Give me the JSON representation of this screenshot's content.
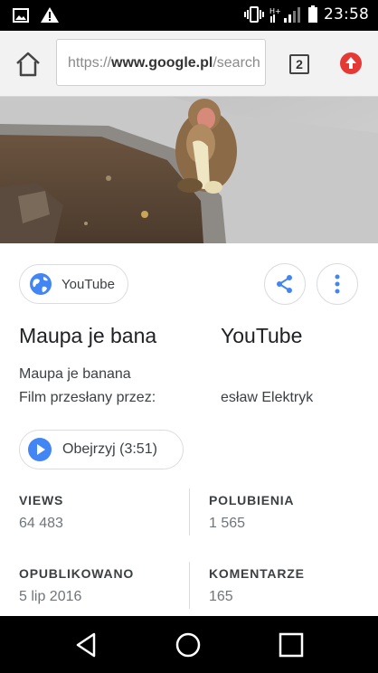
{
  "status_bar": {
    "time": "23:58",
    "icons": [
      "image-icon",
      "warning-icon",
      "vibrate-icon",
      "signal-icon",
      "battery-icon"
    ]
  },
  "browser": {
    "url_scheme": "https://",
    "url_host": "www.google.pl",
    "url_rest": "/search",
    "tab_count": "2",
    "accent": "#e53935"
  },
  "card": {
    "source_label": "YouTube",
    "title_left": "Maupa je bana",
    "title_right": "YouTube",
    "description_line1": "Maupa je banana",
    "description_line2": "Film przesłany przez:",
    "uploader": "esław Elektryk",
    "watch_label": "Obejrzyj (3:51)",
    "accent": "#4285f4"
  },
  "stats": {
    "views_label": "VIEWS",
    "views_value": "64 483",
    "likes_label": "POLUBIENIA",
    "likes_value": "1 565",
    "published_label": "OPUBLIKOWANO",
    "published_value": "5 lip 2016",
    "comments_label": "KOMENTARZE",
    "comments_value": "165"
  }
}
